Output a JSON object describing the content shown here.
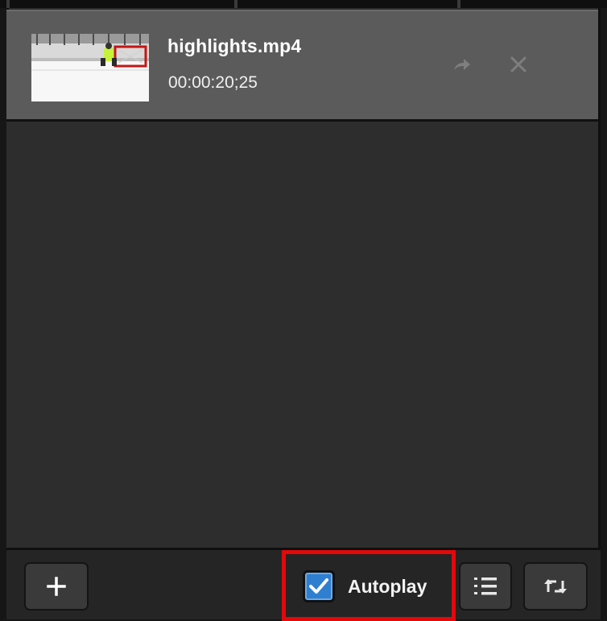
{
  "playlist": {
    "items": [
      {
        "name": "highlights.mp4",
        "duration": "00:00:20;25",
        "thumbnail_icon": "hockey-rink-thumbnail",
        "actions": [
          "forward-arrow-icon",
          "close-icon"
        ]
      }
    ]
  },
  "footer": {
    "add_icon": "plus-icon",
    "autoplay_label": "Autoplay",
    "autoplay_checked": true,
    "list_icon": "numbered-list-icon",
    "repeat_icon": "repeat-icon",
    "highlight_color": "#e4080b",
    "checkbox_color": "#2e7fd0"
  }
}
